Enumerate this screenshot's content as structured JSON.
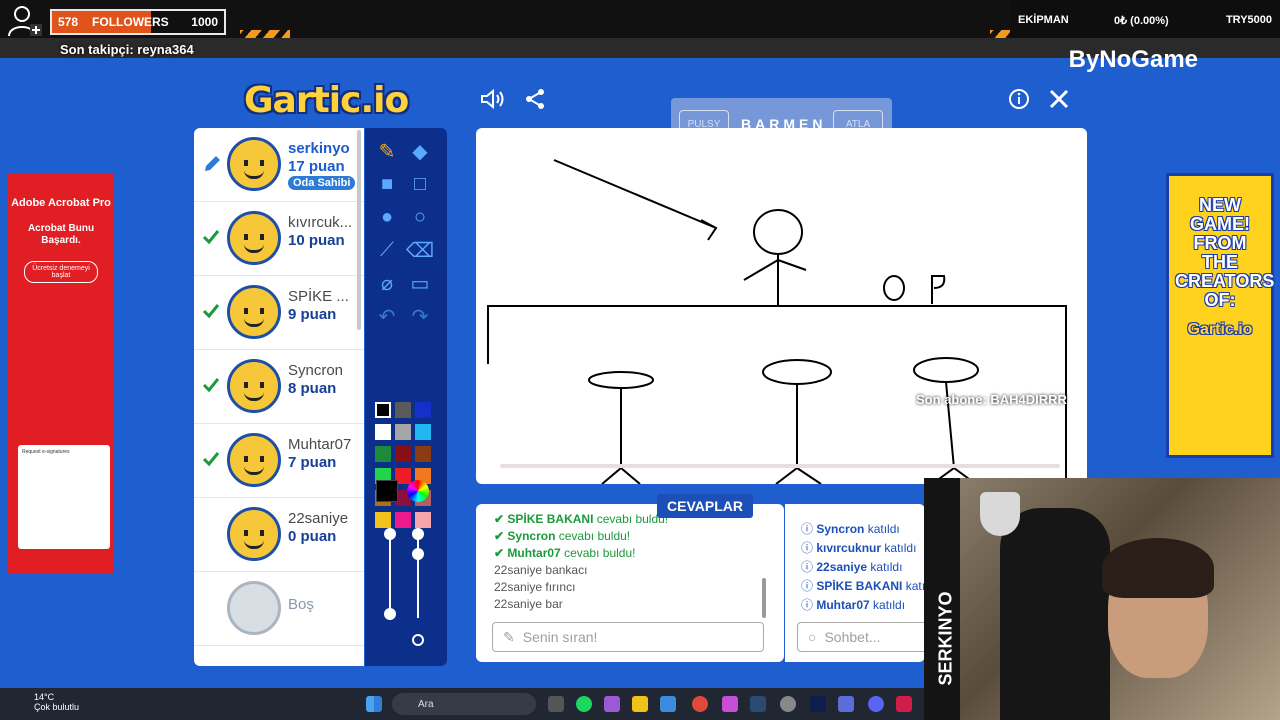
{
  "overlay": {
    "follower_count": "578",
    "followers_label": "FOLLOWERS",
    "follower_goal": "1000",
    "follower_progress_fraction": 0.578,
    "last_follower": "Son takipçi: reyna364",
    "equipment_label": "EKİPMAN",
    "equipment_value": "0₺ (0.00%)",
    "currency": "TRY5000",
    "brand": "ByNoGame",
    "last_sub": "Son abone: BAH4DIRRR",
    "streamer_name": "SERKINYO"
  },
  "game": {
    "logo": "Gartic.io",
    "hint": {
      "skip": "PULSY",
      "word": "BARMEN",
      "jump": "ATLA"
    },
    "answers_tab": "CEVAPLAR"
  },
  "players": [
    {
      "name": "serkinyo",
      "points": "17 puan",
      "badge": "Oda Sahibi",
      "status": "drawing"
    },
    {
      "name": "kıvırcuk...",
      "points": "10 puan",
      "status": "correct"
    },
    {
      "name": "SPİKE ...",
      "points": "9 puan",
      "status": "correct"
    },
    {
      "name": "Syncron",
      "points": "8 puan",
      "status": "correct"
    },
    {
      "name": "Muhtar07",
      "points": "7 puan",
      "status": "correct"
    },
    {
      "name": "22saniye",
      "points": "0 puan",
      "status": "none"
    },
    {
      "name": "Boş",
      "points": "",
      "status": "empty"
    }
  ],
  "answers": [
    {
      "type": "ok",
      "user": "SPİKE BAKANI",
      "text": "cevabı buldu!"
    },
    {
      "type": "ok",
      "user": "Syncron",
      "text": "cevabı buldu!"
    },
    {
      "type": "ok",
      "user": "Muhtar07",
      "text": "cevabı buldu!"
    },
    {
      "type": "guess",
      "user": "22saniye",
      "text": "bankacı"
    },
    {
      "type": "guess",
      "user": "22saniye",
      "text": "fırıncı"
    },
    {
      "type": "guess",
      "user": "22saniye",
      "text": "bar"
    }
  ],
  "answer_placeholder": "Senin sıran!",
  "chat": [
    {
      "user": "Syncron",
      "text": "katıldı"
    },
    {
      "user": "kıvırcuknur",
      "text": "katıldı"
    },
    {
      "user": "22saniye",
      "text": "katıldı"
    },
    {
      "user": "SPİKE BAKANI",
      "text": "katıldı"
    },
    {
      "user": "Muhtar07",
      "text": "katıldı"
    }
  ],
  "chat_placeholder": "Sohbet...",
  "ads": {
    "left_title": "Adobe Acrobat Pro",
    "left_sub": "Acrobat Bunu Başardı.",
    "left_btn": "Ücretsiz denemeyi başlat",
    "left_mock_title": "Request e-signatures",
    "right_text": "NEW GAME! FROM THE CREATORS OF:",
    "right_logo": "Gartic.io"
  },
  "taskbar": {
    "temp": "14°C",
    "weather": "Çok bulutlu",
    "search": "Ara"
  },
  "colors": {
    "game_bg": "#1f5ecf",
    "tool_panel": "#0c2f8c",
    "accent_orange": "#e0541c",
    "correct_green": "#1b9a3b"
  },
  "palette": [
    "#000000",
    "#5a5a5a",
    "#1330c8",
    "#ffffff",
    "#a5a5a5",
    "#22b7f0",
    "#1c8a3a",
    "#8a0f14",
    "#8a3b14",
    "#22d44a",
    "#ee1c24",
    "#f07820",
    "#a8701c",
    "#8a1040",
    "#b06060",
    "#f2c21a",
    "#ee1a8c",
    "#f7a5a8"
  ]
}
